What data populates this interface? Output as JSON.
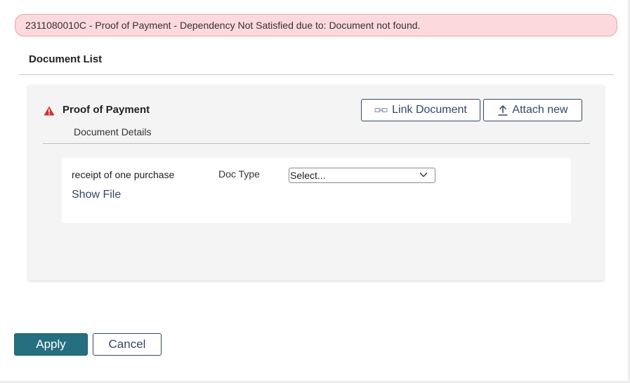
{
  "alert": {
    "message": "2311080010C - Proof of Payment - Dependency Not Satisfied due to: Document not found."
  },
  "document_list": {
    "title": "Document List",
    "card": {
      "title": "Proof of Payment",
      "subtitle": "Document Details",
      "status_icon": "warning-icon",
      "link_button_label": "Link Document",
      "link_button_icon": "link-icon",
      "attach_button_label": "Attach new",
      "attach_button_icon": "upload-icon",
      "file": {
        "name": "receipt of one purchase",
        "show_file_label": "Show File",
        "doc_type_label": "Doc Type",
        "doc_type_value": "Select..."
      }
    }
  },
  "actions": {
    "apply_label": "Apply",
    "cancel_label": "Cancel"
  },
  "colors": {
    "alert_bg": "#fcd9dc",
    "alert_border": "#e8a6a8",
    "primary": "#256f80",
    "outline": "#33476b",
    "warning": "#d32f2f"
  }
}
